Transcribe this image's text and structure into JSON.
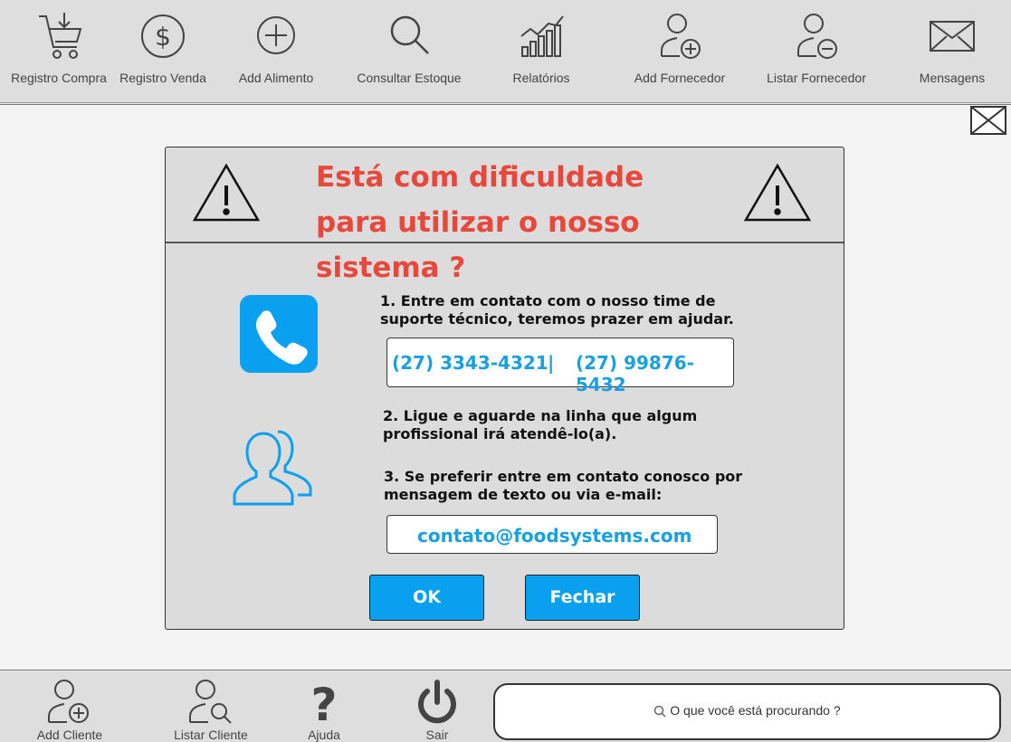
{
  "toolbar": {
    "items": [
      {
        "label": "Registro Compra",
        "icon": "cart-icon"
      },
      {
        "label": "Registro Venda",
        "icon": "dollar-icon"
      },
      {
        "label": "Add Alimento",
        "icon": "plus-circle-icon"
      },
      {
        "label": "Consultar Estoque",
        "icon": "search-icon"
      },
      {
        "label": "Relatórios",
        "icon": "bar-chart-icon"
      },
      {
        "label": "Add Fornecedor",
        "icon": "user-add-icon"
      },
      {
        "label": "Listar Fornecedor",
        "icon": "user-remove-icon"
      },
      {
        "label": "Mensagens",
        "icon": "envelope-icon"
      }
    ]
  },
  "dialog": {
    "title": "Está com dificuldade para utilizar o nosso sistema ?",
    "step1": "1. Entre em contato com o nosso time de suporte técnico, teremos prazer em ajudar.",
    "phone1": "(27) 3343-4321",
    "phone_sep": "|",
    "phone2": "(27) 99876-5432",
    "step2": "2. Ligue e aguarde na linha que algum profissional irá atendê-lo(a).",
    "step3": "3. Se preferir entre em contato conosco por mensagem de texto ou via e-mail:",
    "email": "contato@foodsystems.com",
    "ok_label": "OK",
    "close_label": "Fechar"
  },
  "bottombar": {
    "items": [
      {
        "label": "Add Cliente",
        "icon": "user-add-icon"
      },
      {
        "label": "Listar Cliente",
        "icon": "user-search-icon"
      },
      {
        "label": "Ajuda",
        "icon": "question-icon"
      },
      {
        "label": "Sair",
        "icon": "power-icon"
      }
    ],
    "search_placeholder": "O que você está procurando ?"
  },
  "colors": {
    "title_red": "#e8483b",
    "accent_blue": "#0aa0f0",
    "link_blue": "#1aa0e0"
  }
}
